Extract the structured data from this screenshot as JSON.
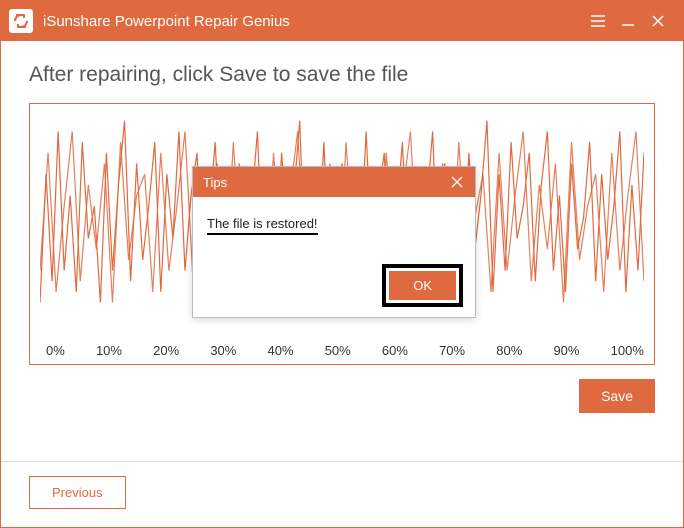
{
  "app": {
    "title": "iSunshare Powerpoint Repair Genius"
  },
  "colors": {
    "accent": "#e06a3f"
  },
  "page": {
    "heading": "After repairing, click Save to save the file",
    "save_label": "Save",
    "previous_label": "Previous",
    "xaxis_ticks": [
      "0%",
      "10%",
      "20%",
      "30%",
      "40%",
      "50%",
      "60%",
      "70%",
      "80%",
      "90%",
      "100%"
    ]
  },
  "dialog": {
    "title": "Tips",
    "message": "The file is restored!",
    "ok_label": "OK"
  }
}
